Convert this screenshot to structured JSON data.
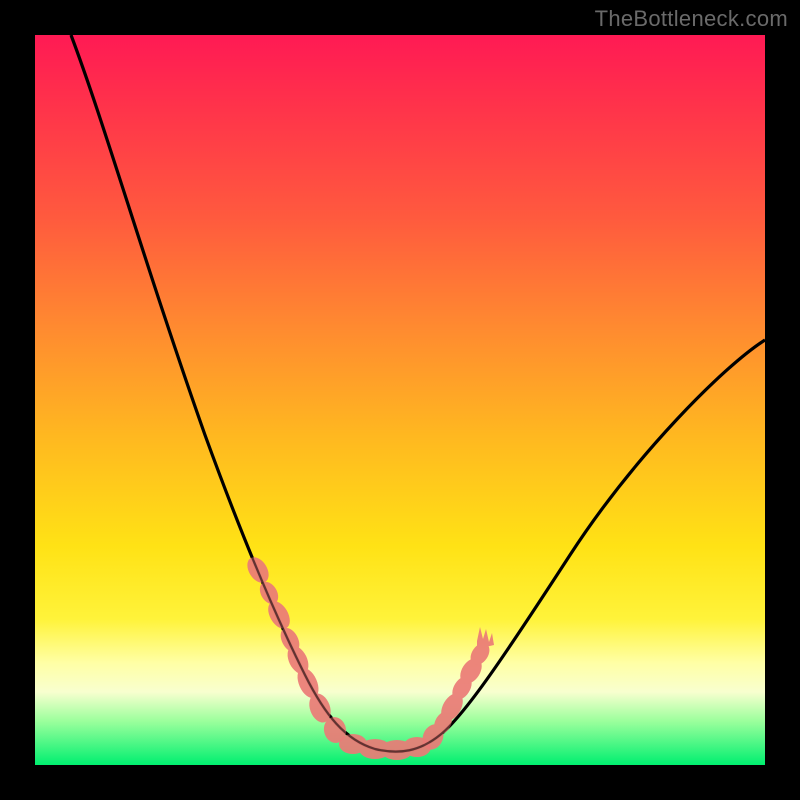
{
  "watermark": "TheBottleneck.com",
  "chart_data": {
    "type": "line",
    "title": "",
    "xlabel": "",
    "ylabel": "",
    "xlim": [
      0,
      100
    ],
    "ylim": [
      0,
      100
    ],
    "grid": false,
    "legend": false,
    "series": [
      {
        "name": "bottleneck-curve",
        "color": "#000000",
        "x": [
          5,
          10,
          15,
          20,
          25,
          30,
          33,
          36,
          38,
          40,
          42,
          44,
          46,
          48,
          50,
          53,
          56,
          60,
          65,
          70,
          75,
          80,
          85,
          90,
          95,
          100
        ],
        "y": [
          100,
          86,
          72,
          58,
          45,
          32,
          24,
          17,
          12,
          8,
          5,
          3,
          2,
          2,
          2,
          3,
          5,
          9,
          15,
          22,
          29,
          36,
          42,
          48,
          53,
          57
        ]
      }
    ],
    "highlight": {
      "name": "highlighted-points",
      "color": "#e57373",
      "x": [
        30,
        32,
        33.5,
        35,
        36,
        37.5,
        39,
        41,
        43,
        45,
        47,
        49,
        50,
        51,
        52,
        53,
        54,
        55.5,
        57
      ],
      "y": [
        32,
        27,
        23,
        20,
        17,
        14,
        11,
        7.2,
        4.8,
        3.2,
        2.4,
        2.1,
        2,
        2.1,
        2.4,
        3.2,
        4.2,
        5.6,
        7.4
      ]
    },
    "notes": "Axis values are estimated from the image (no tick labels visible). y=0 corresponds to the green bottom strip (ideal / no bottleneck), y=100 to the top. The curve reaches its minimum near x≈48 at y≈2."
  }
}
